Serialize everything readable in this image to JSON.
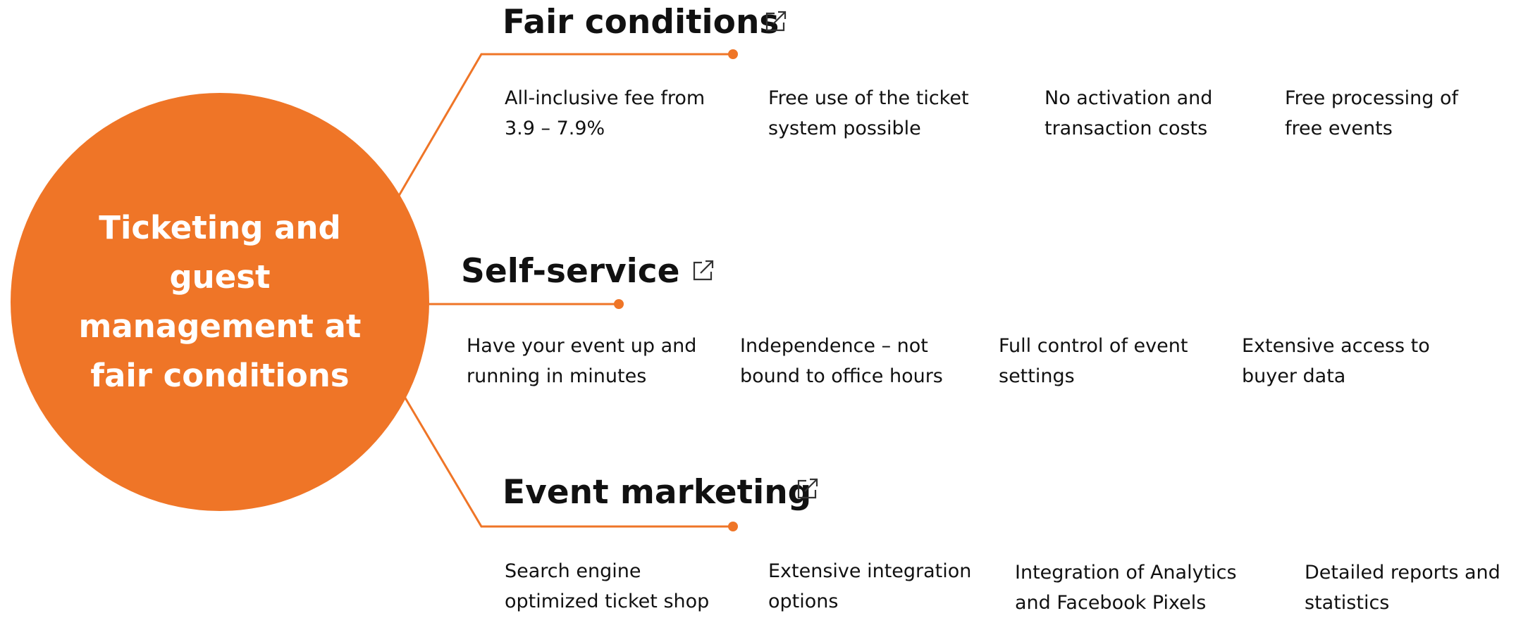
{
  "colors": {
    "accent": "#ef7527",
    "text": "#111111",
    "background": "#ffffff"
  },
  "hub": {
    "title": "Ticketing and guest management at fair conditions"
  },
  "branches": [
    {
      "title": "Fair conditions",
      "icon": "external-link-icon",
      "items": [
        "All-inclusive fee from 3.9 – 7.9%",
        "Free use of the ticket system possible",
        "No activation and transaction costs",
        "Free processing of free events"
      ]
    },
    {
      "title": "Self-service",
      "icon": "external-link-icon",
      "items": [
        "Have your event up and running in minutes",
        "Independence – not bound to office hours",
        "Full control of event settings",
        "Extensive access to buyer data"
      ]
    },
    {
      "title": "Event marketing",
      "icon": "external-link-icon",
      "items": [
        "Search engine optimized ticket shop",
        "Extensive integration options",
        "Integration of Analytics and Facebook Pixels",
        "Detailed reports and statistics"
      ]
    }
  ]
}
